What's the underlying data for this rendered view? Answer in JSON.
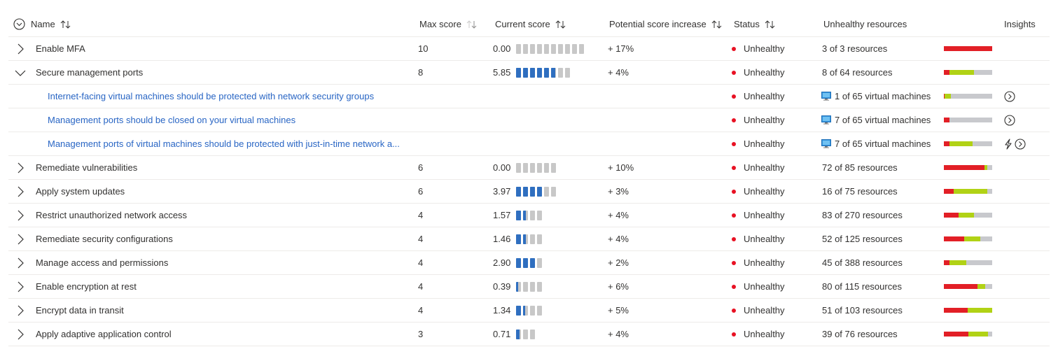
{
  "header": {
    "select_all": "",
    "name": "Name",
    "max_score": "Max score",
    "current_score": "Current score",
    "potential": "Potential score increase",
    "status": "Status",
    "unhealthy": "Unhealthy resources",
    "insights": "Insights"
  },
  "colors": {
    "blue_block": "#2f6fc0",
    "empty_block": "#c8c8c8",
    "red": "#e21f26",
    "green": "#b1d215",
    "gray": "#c8c9cd",
    "link": "#2865c4",
    "status_dot": "#e81123"
  },
  "rows": [
    {
      "type": "control",
      "expanded": false,
      "name": "Enable MFA",
      "max": "10",
      "current": "0.00",
      "blocks_total": 10,
      "blocks_filled": 0,
      "potential": "+ 17%",
      "status": "Unhealthy",
      "resources": "3 of 3 resources",
      "bar": [
        1.0,
        0.0
      ]
    },
    {
      "type": "control",
      "expanded": true,
      "name": "Secure management ports",
      "max": "8",
      "current": "5.85",
      "blocks_total": 8,
      "blocks_filled": 5.85,
      "potential": "+ 4%",
      "status": "Unhealthy",
      "resources": "8 of 64 resources",
      "bar": [
        0.12,
        0.5
      ]
    },
    {
      "type": "recommendation",
      "name": "Internet-facing virtual machines should be protected with network security groups",
      "status": "Unhealthy",
      "resources": "1 of 65 virtual machines",
      "bar": [
        0.02,
        0.12
      ],
      "insights": [
        "chevron-circle-icon"
      ]
    },
    {
      "type": "recommendation",
      "name": "Management ports should be closed on your virtual machines",
      "status": "Unhealthy",
      "resources": "7 of 65 virtual machines",
      "bar": [
        0.11,
        0.0
      ],
      "insights": [
        "chevron-circle-icon"
      ]
    },
    {
      "type": "recommendation",
      "name": "Management ports of virtual machines should be protected with just-in-time network a...",
      "status": "Unhealthy",
      "resources": "7 of 65 virtual machines",
      "bar": [
        0.11,
        0.49
      ],
      "insights": [
        "lightning-icon",
        "chevron-circle-icon"
      ]
    },
    {
      "type": "control",
      "expanded": false,
      "name": "Remediate vulnerabilities",
      "max": "6",
      "current": "0.00",
      "blocks_total": 6,
      "blocks_filled": 0,
      "potential": "+ 10%",
      "status": "Unhealthy",
      "resources": "72 of 85 resources",
      "bar": [
        0.84,
        0.06
      ]
    },
    {
      "type": "control",
      "expanded": false,
      "name": "Apply system updates",
      "max": "6",
      "current": "3.97",
      "blocks_total": 6,
      "blocks_filled": 3.97,
      "potential": "+ 3%",
      "status": "Unhealthy",
      "resources": "16 of 75 resources",
      "bar": [
        0.21,
        0.69
      ]
    },
    {
      "type": "control",
      "expanded": false,
      "name": "Restrict unauthorized network access",
      "max": "4",
      "current": "1.57",
      "blocks_total": 4,
      "blocks_filled": 1.57,
      "potential": "+ 4%",
      "status": "Unhealthy",
      "resources": "83 of 270 resources",
      "bar": [
        0.31,
        0.31
      ]
    },
    {
      "type": "control",
      "expanded": false,
      "name": "Remediate security configurations",
      "max": "4",
      "current": "1.46",
      "blocks_total": 4,
      "blocks_filled": 1.46,
      "potential": "+ 4%",
      "status": "Unhealthy",
      "resources": "52 of 125 resources",
      "bar": [
        0.42,
        0.33
      ]
    },
    {
      "type": "control",
      "expanded": false,
      "name": "Manage access and permissions",
      "max": "4",
      "current": "2.90",
      "blocks_total": 4,
      "blocks_filled": 2.9,
      "potential": "+ 2%",
      "status": "Unhealthy",
      "resources": "45 of 388 resources",
      "bar": [
        0.12,
        0.34
      ]
    },
    {
      "type": "control",
      "expanded": false,
      "name": "Enable encryption at rest",
      "max": "4",
      "current": "0.39",
      "blocks_total": 4,
      "blocks_filled": 0.39,
      "potential": "+ 6%",
      "status": "Unhealthy",
      "resources": "80 of 115 resources",
      "bar": [
        0.69,
        0.16
      ]
    },
    {
      "type": "control",
      "expanded": false,
      "name": "Encrypt data in transit",
      "max": "4",
      "current": "1.34",
      "blocks_total": 4,
      "blocks_filled": 1.34,
      "potential": "+ 5%",
      "status": "Unhealthy",
      "resources": "51 of 103 resources",
      "bar": [
        0.49,
        0.51
      ]
    },
    {
      "type": "control",
      "expanded": false,
      "name": "Apply adaptive application control",
      "max": "3",
      "current": "0.71",
      "blocks_total": 3,
      "blocks_filled": 0.71,
      "potential": "+ 4%",
      "status": "Unhealthy",
      "resources": "39 of 76 resources",
      "bar": [
        0.51,
        0.4
      ]
    }
  ]
}
